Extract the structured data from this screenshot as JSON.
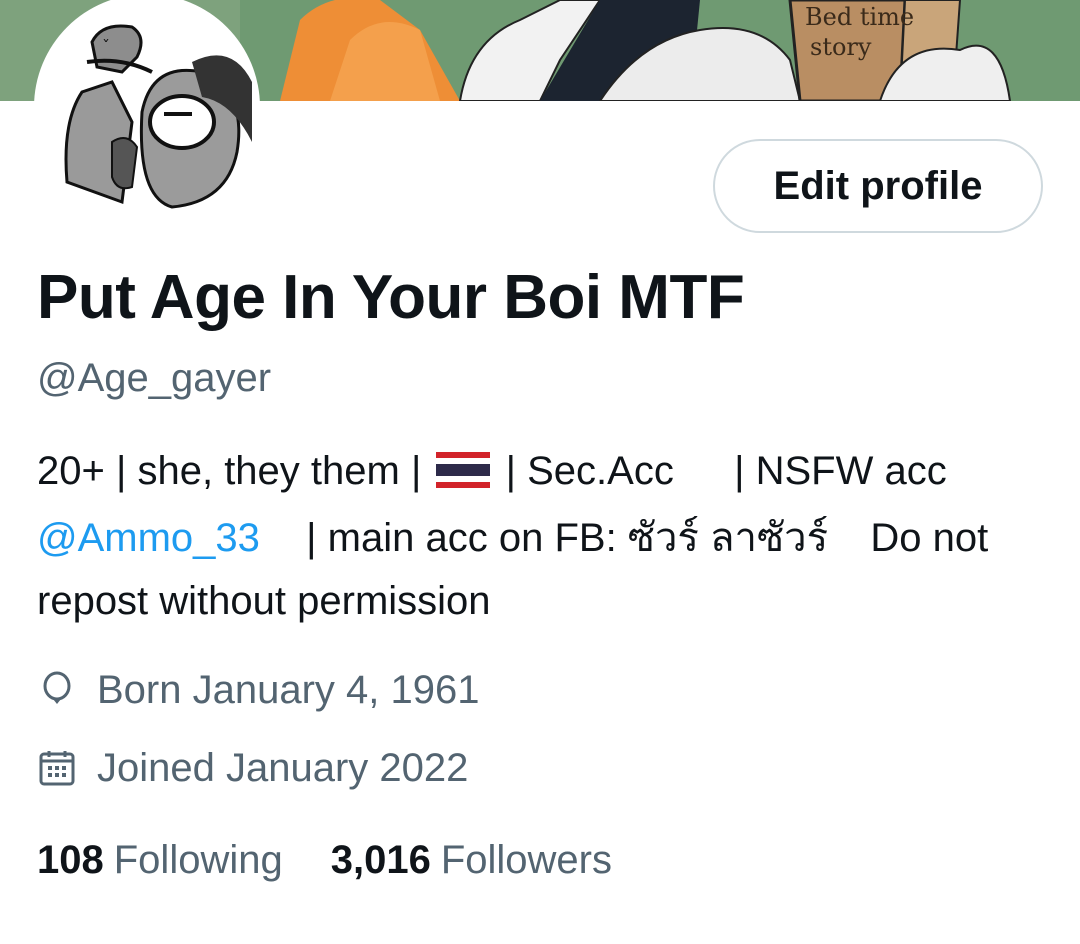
{
  "banner": {
    "book_text_line1": "Bed time",
    "book_text_line2": "story"
  },
  "profile": {
    "display_name": "Put Age In Your Boi MTF",
    "handle": "@Age_gayer",
    "edit_button_label": "Edit profile"
  },
  "bio": {
    "part1": "20+ | she, they them |",
    "part2": "| Sec.Acc",
    "part3": "| NSFW acc",
    "mention": "@Ammo_33",
    "part4": "| main acc on FB: ซัวร์ ลาซัวร์",
    "part5": "Do not",
    "part6": "repost without permission"
  },
  "meta": {
    "birth_icon": "balloon-icon",
    "born": "Born January 4, 1961",
    "joined_icon": "calendar-icon",
    "joined": "Joined January 2022"
  },
  "stats": {
    "following_count": "108",
    "following_label": "Following",
    "followers_count": "3,016",
    "followers_label": "Followers"
  },
  "colors": {
    "accent": "#1d9bf0",
    "secondary_text": "#536471",
    "primary_text": "#0f1419"
  }
}
